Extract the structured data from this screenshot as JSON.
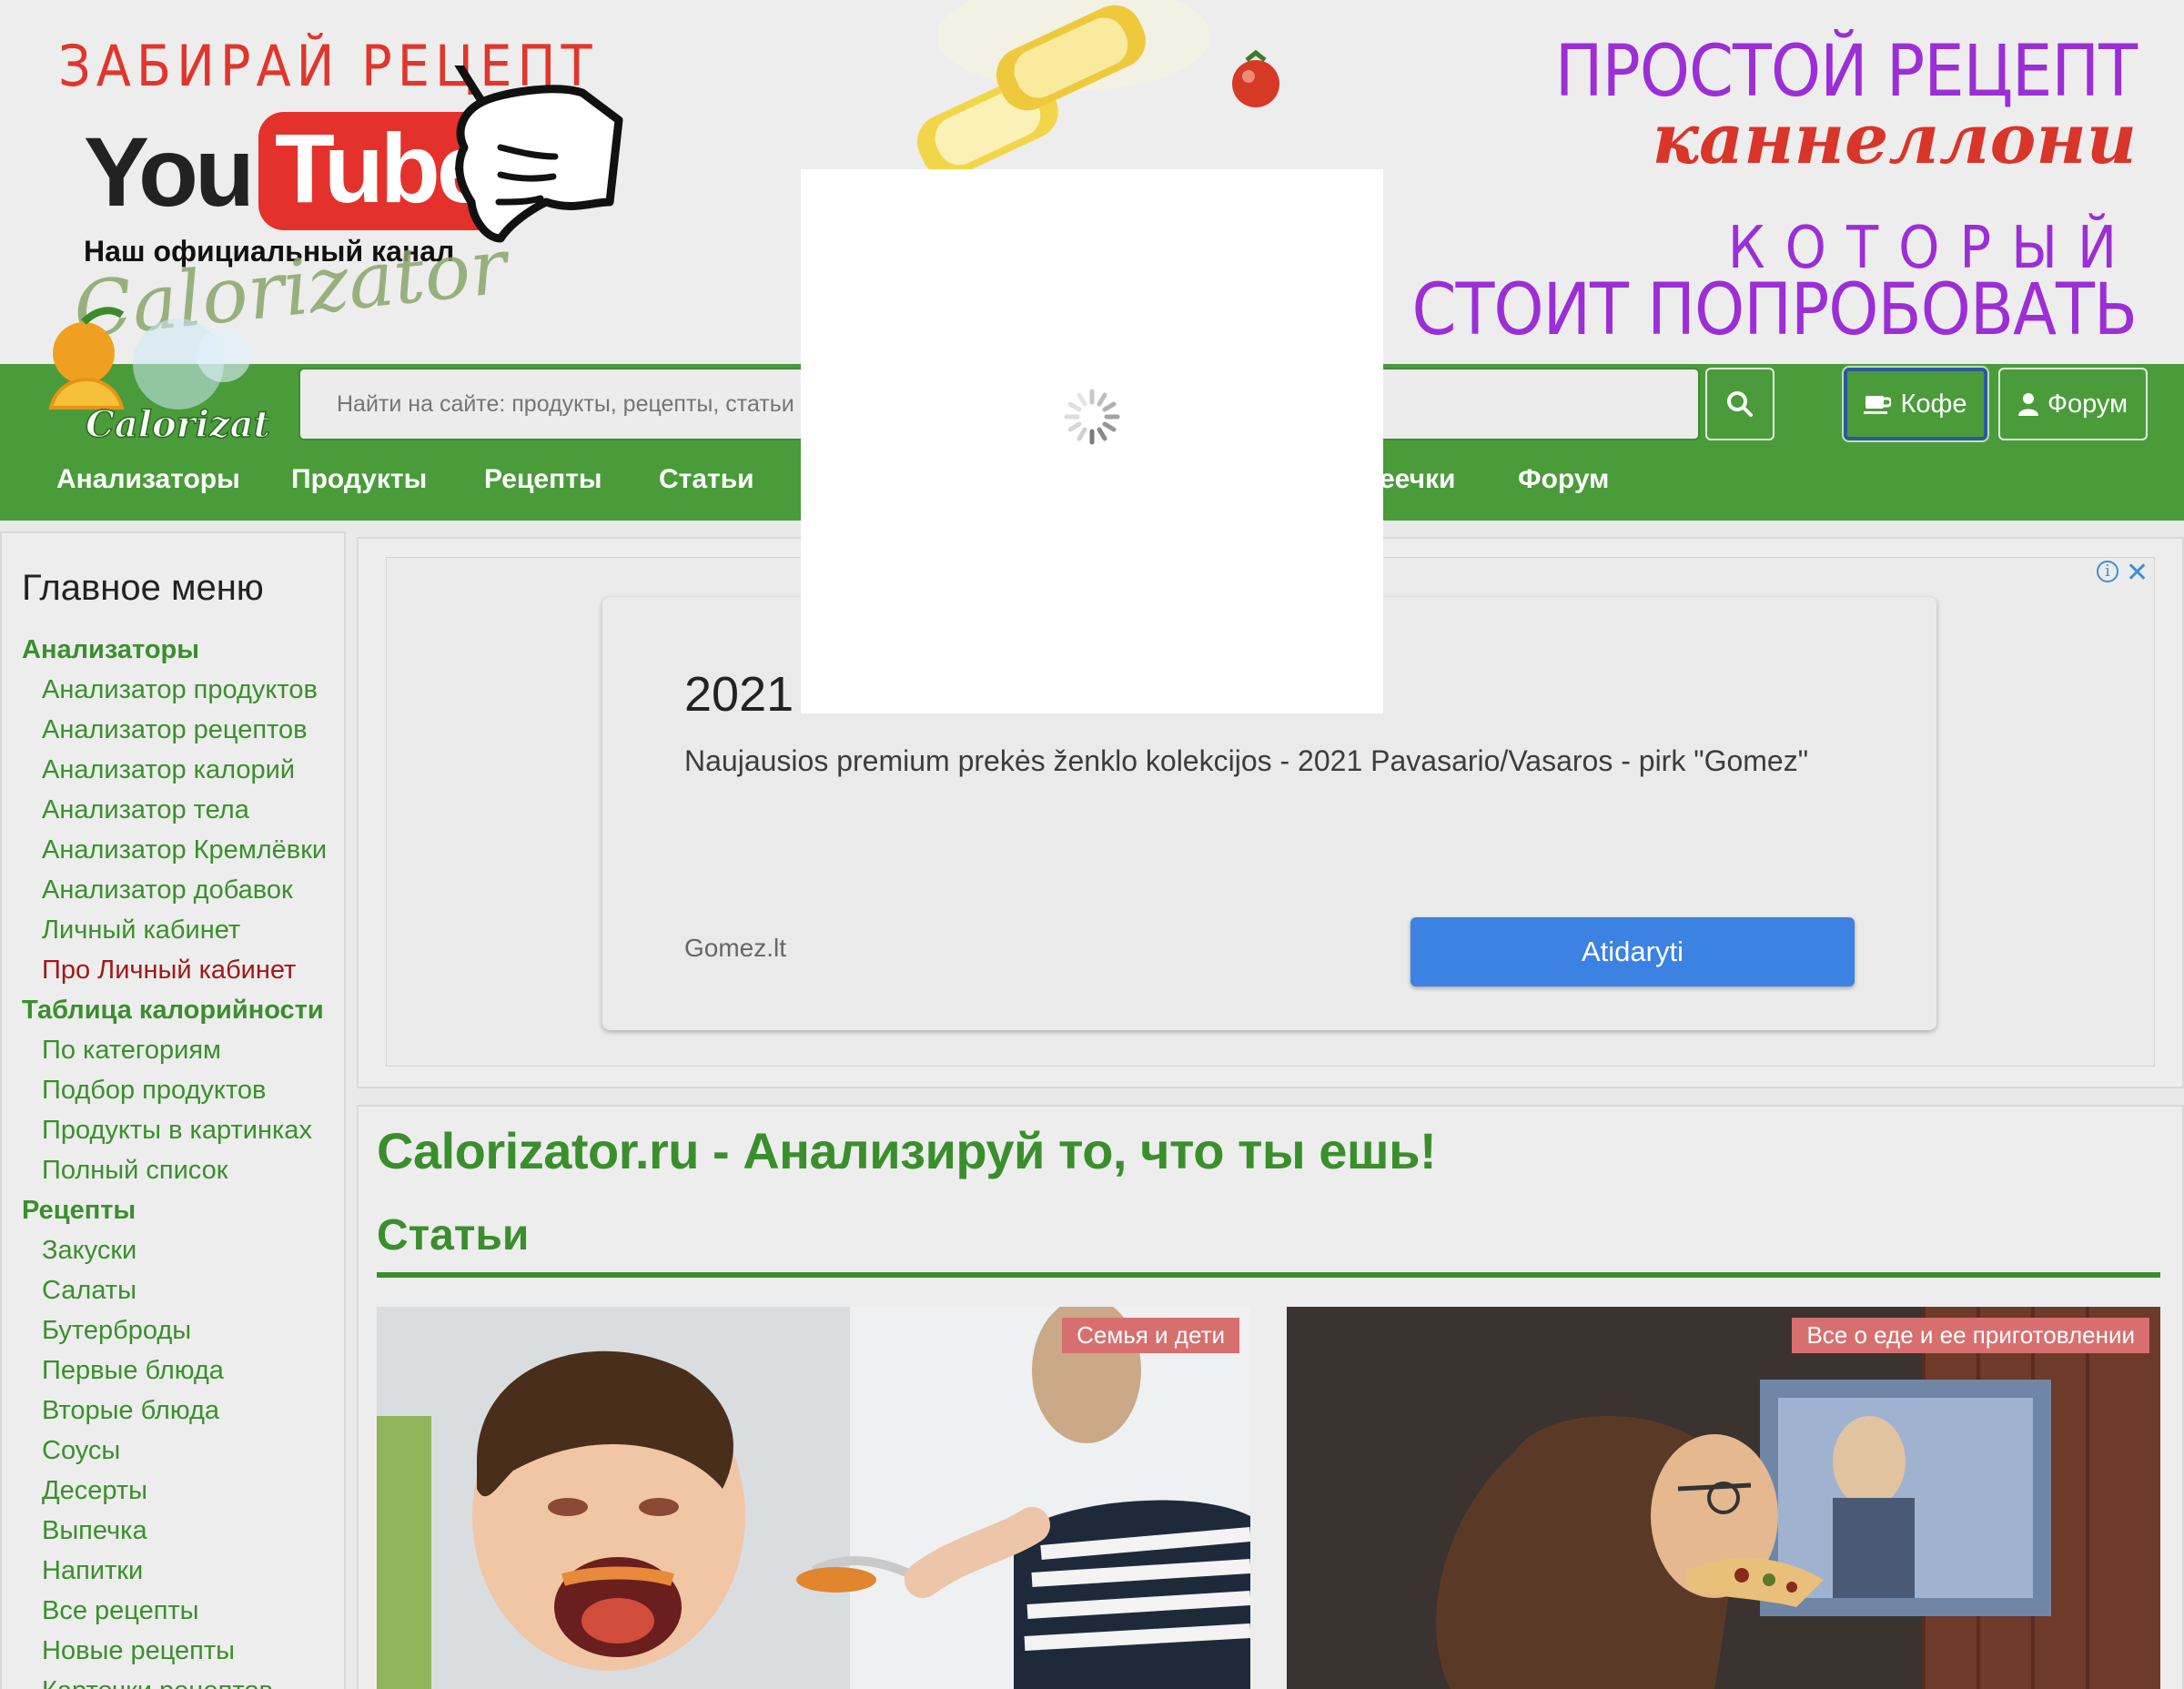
{
  "banner": {
    "left_promo": "ЗАБИРАЙ РЕЦЕПТ",
    "youtube_you": "You",
    "youtube_tube": "Tube",
    "channel_label": "Наш официальный канал",
    "channel_script": "Calorizator",
    "right_line1": "ПРОСТОЙ РЕЦЕПТ",
    "right_line2": "каннеллони",
    "right_line3": "КОТОРЫЙ",
    "right_line4": "СТОИТ ПОПРОБОВАТЬ"
  },
  "header": {
    "logo_text": "Calorizator",
    "search_placeholder": "Найти на сайте: продукты, рецепты, статьи и ...",
    "coffee_label": "Кофе",
    "forum_label": "Форум",
    "nav": [
      "Анализаторы",
      "Продукты",
      "Рецепты",
      "Статьи",
      "еечки",
      "Форум"
    ]
  },
  "sidebar": {
    "title": "Главное меню",
    "items": [
      {
        "label": "Анализаторы",
        "kind": "cat"
      },
      {
        "label": "Анализатор продуктов",
        "kind": "link"
      },
      {
        "label": "Анализатор рецептов",
        "kind": "link"
      },
      {
        "label": "Анализатор калорий",
        "kind": "link"
      },
      {
        "label": "Анализатор тела",
        "kind": "link"
      },
      {
        "label": "Анализатор Кремлёвки",
        "kind": "link"
      },
      {
        "label": "Анализатор добавок",
        "kind": "link"
      },
      {
        "label": "Личный кабинет",
        "kind": "link"
      },
      {
        "label": "Про Личный кабинет",
        "kind": "red"
      },
      {
        "label": "Таблица калорийности",
        "kind": "cat"
      },
      {
        "label": "По категориям",
        "kind": "link"
      },
      {
        "label": "Подбор продуктов",
        "kind": "link"
      },
      {
        "label": "Продукты в картинках",
        "kind": "link"
      },
      {
        "label": "Полный список",
        "kind": "link"
      },
      {
        "label": "Рецепты",
        "kind": "cat"
      },
      {
        "label": "Закуски",
        "kind": "link"
      },
      {
        "label": "Салаты",
        "kind": "link"
      },
      {
        "label": "Бутерброды",
        "kind": "link"
      },
      {
        "label": "Первые блюда",
        "kind": "link"
      },
      {
        "label": "Вторые блюда",
        "kind": "link"
      },
      {
        "label": "Соусы",
        "kind": "link"
      },
      {
        "label": "Десерты",
        "kind": "link"
      },
      {
        "label": "Выпечка",
        "kind": "link"
      },
      {
        "label": "Напитки",
        "kind": "link"
      },
      {
        "label": "Все рецепты",
        "kind": "link"
      },
      {
        "label": "Новые рецепты",
        "kind": "link"
      },
      {
        "label": "Карточки рецептов",
        "kind": "link"
      }
    ]
  },
  "ad": {
    "title": "2021",
    "description": "Naujausios premium prekės ženklo kolekcijos - 2021 Pavasario/Vasaros - pirk \"Gomez\"",
    "domain": "Gomez.lt",
    "cta": "Atidaryti",
    "info_icon": "info-icon",
    "close_icon": "close-icon"
  },
  "main": {
    "site_title": "Calorizator.ru - Анализируй то, что ты ешь!",
    "section_title": "Статьи",
    "cards": [
      {
        "tag": "Семья и дети"
      },
      {
        "tag": "Все о еде и ее приготовлении"
      }
    ]
  },
  "colors": {
    "brand_green": "#4a9c3a",
    "link_green": "#3a8f2c",
    "promo_red": "#e0362b",
    "promo_purple": "#9c2ed6",
    "ad_cta_blue": "#3b82e2",
    "tag_red": "#d86f6f"
  }
}
